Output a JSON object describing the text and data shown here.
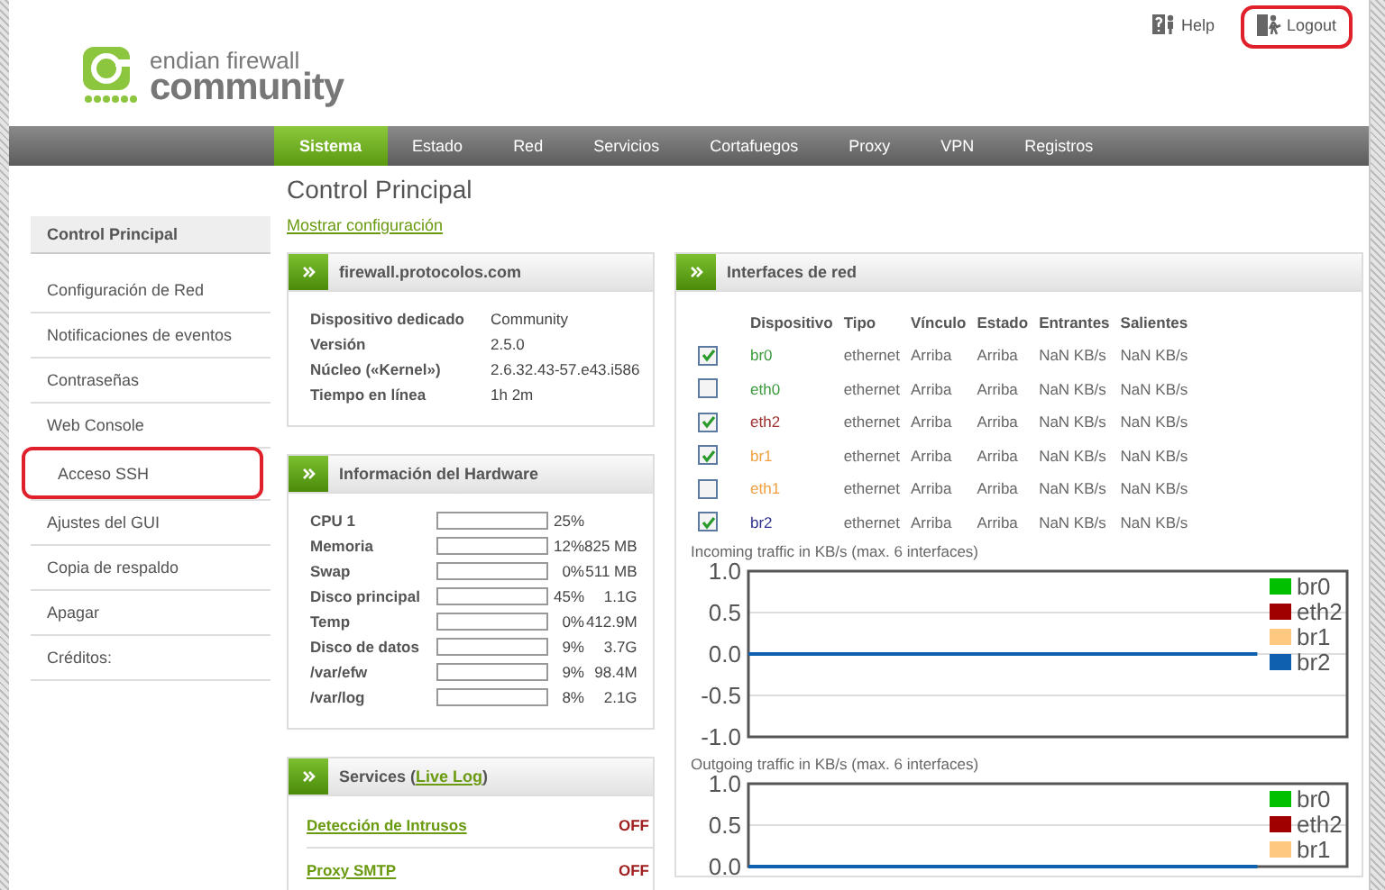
{
  "header": {
    "logo": {
      "line1": "endian firewall",
      "line2": "community"
    },
    "links": [
      {
        "label": "Help",
        "kind": "help",
        "highlighted": false
      },
      {
        "label": "Logout",
        "kind": "logout",
        "highlighted": true
      }
    ]
  },
  "nav": [
    {
      "label": "Sistema",
      "selected": true
    },
    {
      "label": "Estado",
      "selected": false
    },
    {
      "label": "Red",
      "selected": false
    },
    {
      "label": "Servicios",
      "selected": false
    },
    {
      "label": "Cortafuegos",
      "selected": false
    },
    {
      "label": "Proxy",
      "selected": false
    },
    {
      "label": "VPN",
      "selected": false
    },
    {
      "label": "Registros",
      "selected": false
    }
  ],
  "page": {
    "title": "Control Principal",
    "link": "Mostrar configuración"
  },
  "sidebar": {
    "items": [
      {
        "label": "Control Principal",
        "selected": true,
        "highlighted": false
      },
      {
        "label": "Configuración de Red",
        "selected": false,
        "highlighted": false
      },
      {
        "label": "Notificaciones de eventos",
        "selected": false,
        "highlighted": false
      },
      {
        "label": "Contraseñas",
        "selected": false,
        "highlighted": false
      },
      {
        "label": "Web Console",
        "selected": false,
        "highlighted": false
      },
      {
        "label": "Acceso SSH",
        "selected": false,
        "highlighted": true
      },
      {
        "label": "Ajustes del GUI",
        "selected": false,
        "highlighted": false
      },
      {
        "label": "Copia de respaldo",
        "selected": false,
        "highlighted": false
      },
      {
        "label": "Apagar",
        "selected": false,
        "highlighted": false
      },
      {
        "label": "Créditos:",
        "selected": false,
        "highlighted": false
      }
    ]
  },
  "device_panel": {
    "title": "firewall.protocolos.com",
    "rows": [
      {
        "label": "Dispositivo dedicado",
        "value": "Community"
      },
      {
        "label": "Versión",
        "value": "2.5.0"
      },
      {
        "label": "Núcleo («Kernel»)",
        "value": "2.6.32.43-57.e43.i586"
      },
      {
        "label": "Tiempo en línea",
        "value": "1h 2m"
      }
    ]
  },
  "hardware_panel": {
    "title": "Información del Hardware",
    "rows": [
      {
        "label": "CPU 1",
        "percent": "25%"
      },
      {
        "label": "Memoria",
        "percent": "12%",
        "amount": "825 MB"
      },
      {
        "label": "Swap",
        "percent": "0%",
        "amount": "511 MB"
      },
      {
        "label": "Disco principal",
        "percent": "45%",
        "amount": "1.1G"
      },
      {
        "label": "Temp",
        "percent": "0%",
        "amount": "412.9M"
      },
      {
        "label": "Disco de datos",
        "percent": "9%",
        "amount": "3.7G"
      },
      {
        "label": "/var/efw",
        "percent": "9%",
        "amount": "98.4M"
      },
      {
        "label": "/var/log",
        "percent": "8%",
        "amount": "2.1G"
      }
    ]
  },
  "services_panel": {
    "title_before": "Services (",
    "title_link": "Live Log",
    "title_after": ")",
    "items": [
      {
        "name": "Detección de Intrusos",
        "status": "OFF"
      },
      {
        "name": "Proxy SMTP",
        "status": "OFF"
      }
    ]
  },
  "interfaces_panel": {
    "title": "Interfaces de red",
    "columns": [
      "Dispositivo",
      "Tipo",
      "Vínculo",
      "Estado",
      "Entrantes",
      "Salientes"
    ],
    "rows": [
      {
        "checked": true,
        "device": "br0",
        "color": "#3c9a3c",
        "type": "ethernet",
        "link": "Arriba",
        "state": "Arriba",
        "incoming": "NaN KB/s",
        "outgoing": "NaN KB/s"
      },
      {
        "checked": false,
        "device": "eth0",
        "color": "#3c9a3c",
        "type": "ethernet",
        "link": "Arriba",
        "state": "Arriba",
        "incoming": "NaN KB/s",
        "outgoing": "NaN KB/s"
      },
      {
        "checked": true,
        "device": "eth2",
        "color": "#a03030",
        "type": "ethernet",
        "link": "Arriba",
        "state": "Arriba",
        "incoming": "NaN KB/s",
        "outgoing": "NaN KB/s"
      },
      {
        "checked": true,
        "device": "br1",
        "color": "#f0a040",
        "type": "ethernet",
        "link": "Arriba",
        "state": "Arriba",
        "incoming": "NaN KB/s",
        "outgoing": "NaN KB/s"
      },
      {
        "checked": false,
        "device": "eth1",
        "color": "#f0a040",
        "type": "ethernet",
        "link": "Arriba",
        "state": "Arriba",
        "incoming": "NaN KB/s",
        "outgoing": "NaN KB/s"
      },
      {
        "checked": true,
        "device": "br2",
        "color": "#303090",
        "type": "ethernet",
        "link": "Arriba",
        "state": "Arriba",
        "incoming": "NaN KB/s",
        "outgoing": "NaN KB/s"
      }
    ],
    "charts": [
      {
        "caption": "Incoming traffic in KB/s (max. 6 interfaces)",
        "axis_labels": [
          "1.0",
          "0.5",
          "0.0",
          "-0.5",
          "-1.0"
        ],
        "legend": [
          {
            "name": "br0",
            "color": "#00c000"
          },
          {
            "name": "eth2",
            "color": "#a00000"
          },
          {
            "name": "br1",
            "color": "#ffc880"
          },
          {
            "name": "br2",
            "color": "#1060b0"
          }
        ]
      },
      {
        "caption": "Outgoing traffic in KB/s (max. 6 interfaces)",
        "axis_labels": [
          "1.0",
          "0.5",
          "0.0"
        ],
        "legend": [
          {
            "name": "br0",
            "color": "#00c000"
          },
          {
            "name": "eth2",
            "color": "#a00000"
          },
          {
            "name": "br1",
            "color": "#ffc880"
          }
        ]
      }
    ]
  }
}
